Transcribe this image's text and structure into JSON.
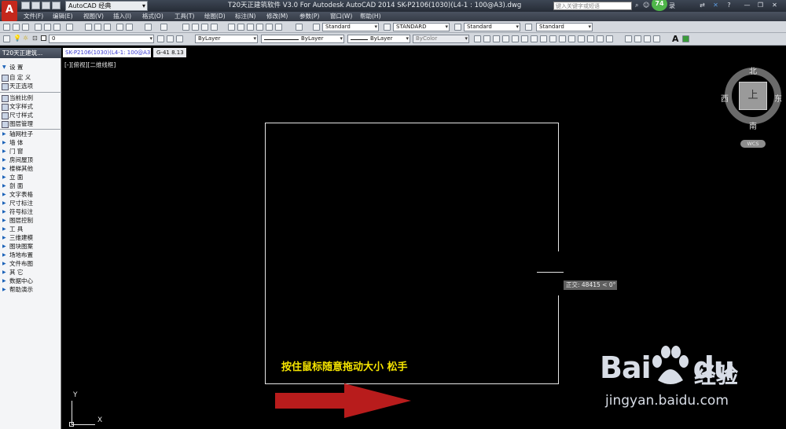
{
  "title_bar": {
    "app_icon_letter": "A",
    "workspace": "AutoCAD 经典",
    "window_title": "T20天正建筑软件 V3.0 For Autodesk AutoCAD 2014    SK-P2106(1030)(L4-1 : 100@A3).dwg",
    "search_placeholder": "键入关键字或短语",
    "notification_count": "74",
    "user_partial": "录",
    "close_x": "✕",
    "minimize": "—",
    "restore": "❐"
  },
  "menu": {
    "items": [
      "文件(F)",
      "编辑(E)",
      "视图(V)",
      "插入(I)",
      "格式(O)",
      "工具(T)",
      "绘图(D)",
      "标注(N)",
      "修改(M)",
      "参数(P)",
      "窗口(W)",
      "帮助(H)"
    ]
  },
  "toolbar_styles": {
    "text_style": "Standard",
    "dim_style": "STANDARD",
    "table_style": "Standard",
    "multileader_style": "Standard"
  },
  "toolbar_layers": {
    "layer_value": "0",
    "color": "ByLayer",
    "linetype": "ByLayer",
    "lineweight": "ByLayer",
    "plotstyle": "ByColor",
    "text_tool": "A"
  },
  "palette": {
    "title": "T20天正建筑...",
    "settings_header": "设  置",
    "top_items": [
      "自 定 义",
      "天正选项"
    ],
    "icon_items": [
      "当前比例",
      "文字样式",
      "尺寸样式",
      "图层管理"
    ],
    "categories": [
      "轴网柱子",
      "墙    体",
      "门    窗",
      "房间屋顶",
      "楼梯其他",
      "立    面",
      "剖    面",
      "文字表格",
      "尺寸标注",
      "符号标注",
      "图层控制",
      "工    具",
      "三维建模",
      "图块图案",
      "场地布置",
      "文件布图",
      "其    它",
      "数据中心",
      "帮助演示"
    ]
  },
  "drawing_tabs": {
    "file_tab": "SK-P2106(1030)(L4-1: 100@A3)",
    "scale_tab": "G-41 8.13"
  },
  "viewport": {
    "view_label": "[-][俯视][二维线框]",
    "tooltip": "正交: 48415 < 0°",
    "caption": "按住鼠标随意拖动大小 松手",
    "ucs_x": "X",
    "ucs_y": "Y"
  },
  "viewcube": {
    "north": "北",
    "south": "南",
    "east": "东",
    "west": "西",
    "face": "上",
    "wcs": "WCS"
  },
  "watermark": {
    "brand": "Bai",
    "brand_tail": "du",
    "cn": "经验",
    "url": "jingyan.baidu.com"
  },
  "colors": {
    "canvas": "#000000",
    "caption": "#f5e400",
    "arrow": "#b81c1c",
    "app_icon": "#c4281c"
  }
}
